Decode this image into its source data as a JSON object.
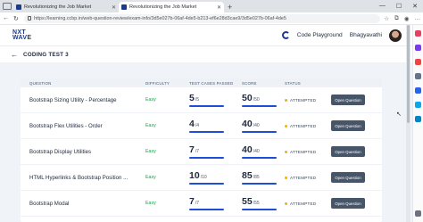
{
  "browser": {
    "tabs": [
      {
        "title": "Revolutionizing the Job Market",
        "active": false
      },
      {
        "title": "Revolutionizing the Job Market",
        "active": true
      }
    ],
    "url": "https://learning.ccbp.in/web-question-review/exam-info/3d5e027b-06af-4de5-b213-ef6e28d3cae9/3d5e027b-06af-4de5"
  },
  "header": {
    "logo_line1": "NXT",
    "logo_line2": "WAVE",
    "code_playground": "Code Playground",
    "username": "Bhagyavathi"
  },
  "page": {
    "title": "CODING TEST 3"
  },
  "table": {
    "columns": [
      "QUESTION",
      "DIFFICULTY",
      "TEST CASES PASSED",
      "SCORE",
      "STATUS"
    ],
    "rows": [
      {
        "question": "Bootstrap Sizing Utility - Percentage",
        "difficulty": "Easy",
        "passed": "5",
        "passed_total": "/5",
        "score": "50",
        "score_total": "/50",
        "status": "ATTEMPTED",
        "action": "Open Question"
      },
      {
        "question": "Bootstrap Flex Utilities - Order",
        "difficulty": "Easy",
        "passed": "4",
        "passed_total": "/4",
        "score": "40",
        "score_total": "/40",
        "status": "ATTEMPTED",
        "action": "Open Question"
      },
      {
        "question": "Bootstrap Display Utilities",
        "difficulty": "Easy",
        "passed": "7",
        "passed_total": "/7",
        "score": "40",
        "score_total": "/40",
        "status": "ATTEMPTED",
        "action": "Open Question"
      },
      {
        "question": "HTML Hyperlinks & Bootstrap Position ...",
        "difficulty": "Easy",
        "passed": "10",
        "passed_total": "/10",
        "score": "85",
        "score_total": "/85",
        "status": "ATTEMPTED",
        "action": "Open Question"
      },
      {
        "question": "Bootstrap Modal",
        "difficulty": "Easy",
        "passed": "7",
        "passed_total": "/7",
        "score": "55",
        "score_total": "/55",
        "status": "ATTEMPTED",
        "action": "Open Question"
      }
    ]
  },
  "colors": {
    "brand": "#1e3a8a",
    "progress": "#1d4ed8",
    "easy": "#16a34a",
    "attempted_dot": "#eab308",
    "button": "#475569"
  }
}
